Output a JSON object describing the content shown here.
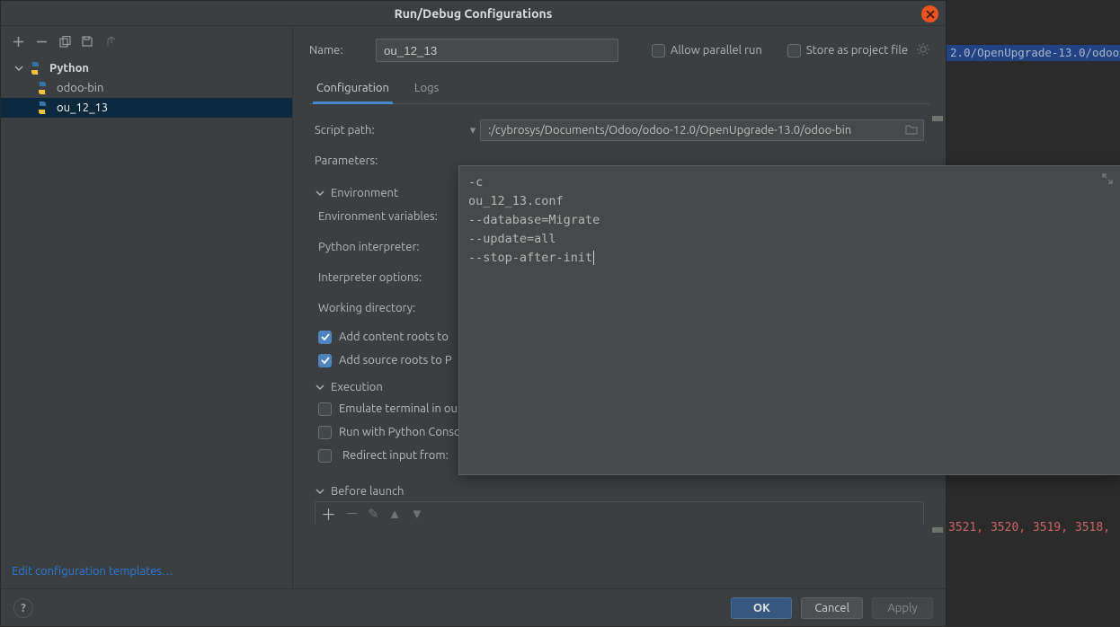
{
  "dialog": {
    "title": "Run/Debug Configurations"
  },
  "tree": {
    "category": "Python",
    "items": [
      "odoo-bin",
      "ou_12_13"
    ],
    "selected_index": 1
  },
  "sidebar_footer": {
    "link": "Edit configuration templates…"
  },
  "top": {
    "name_label": "Name:",
    "name_value": "ou_12_13",
    "allow_parallel": "Allow parallel run",
    "store_project": "Store as project file"
  },
  "tabs": {
    "configuration": "Configuration",
    "logs": "Logs"
  },
  "form": {
    "script_path_label": "Script path:",
    "script_path_value": ":/cybrosys/Documents/Odoo/odoo-12.0/OpenUpgrade-13.0/odoo-bin",
    "parameters_label": "Parameters:",
    "environment_header": "Environment",
    "env_vars_label": "Environment variables:",
    "python_interpreter_label": "Python interpreter:",
    "interpreter_options_label": "Interpreter options:",
    "working_dir_label": "Working directory:",
    "add_content_roots": "Add content roots to",
    "add_source_roots": "Add source roots to P",
    "execution_header": "Execution",
    "emulate_terminal": "Emulate terminal in ou",
    "run_pyconsole": "Run with Python Console",
    "redirect_input": "Redirect input from:",
    "before_launch_header": "Before launch"
  },
  "params_popup": [
    "-c",
    "ou_12_13.conf",
    "--database=Migrate",
    "--update=all",
    "--stop-after-init"
  ],
  "buttons": {
    "ok": "OK",
    "cancel": "Cancel",
    "apply": "Apply"
  },
  "bg": {
    "path_highlight": "2.0/OpenUpgrade-13.0/odoo",
    "red_text": "3521, 3520, 3519, 3518,"
  }
}
